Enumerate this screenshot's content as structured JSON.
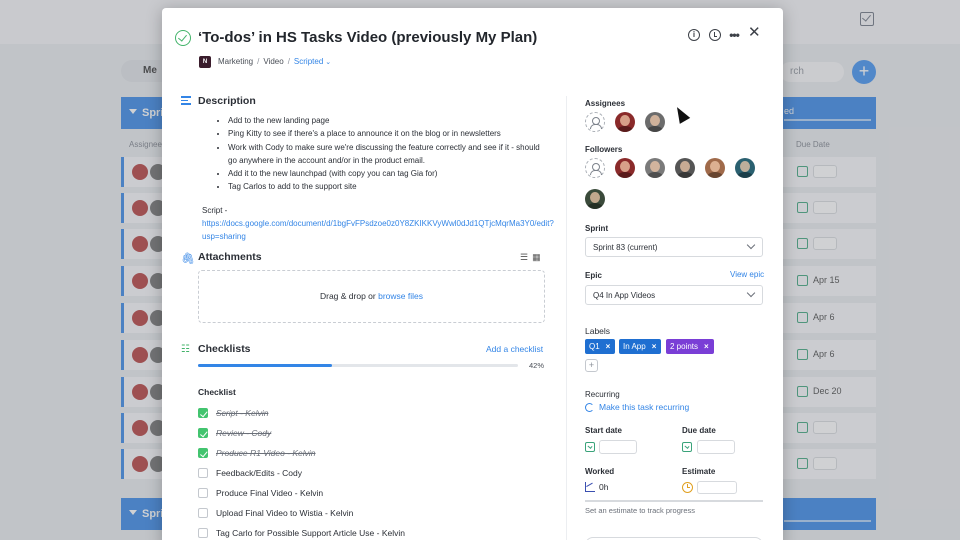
{
  "background": {
    "filter_pill": "Me",
    "search_placeholder": "rch",
    "sprint_bar_top": "Sprin",
    "sprint_bar_bottom": "Sprin",
    "sprint_bar_right_text": "ed",
    "col_assignees": "Assignees",
    "col_due_date": "Due Date",
    "row_dates": [
      "",
      "",
      "",
      "Apr 15",
      "Apr 6",
      "Apr 6",
      "Dec 20",
      "",
      ""
    ]
  },
  "modal": {
    "title": "‘To-dos’ in HS Tasks Video (previously My Plan)",
    "project_badge": "N",
    "breadcrumb": [
      "Marketing",
      "Video"
    ],
    "status": "Scripted",
    "header_icons": [
      "info-icon",
      "clock-icon",
      "more-icon",
      "close-icon"
    ]
  },
  "description": {
    "title": "Description",
    "bullets": [
      "Add to the new landing page",
      "Ping Kitty to see if there's a place to announce it on the blog or in newsletters",
      "Work with Cody to make sure we're discussing the feature correctly and see if it - should go anywhere in the account and/or in the product email.",
      "Add it to the new launchpad (with copy you can tag Gia for)",
      "Tag Carlos to add to the support site"
    ],
    "script_label": "Script - ",
    "script_url": "https://docs.google.com/document/d/1bgFvFPsdzoe0z0Y8ZKIKKVyWwl0dJd1QTjcMqrMa3Y0/edit?usp=sharing"
  },
  "attachments": {
    "title": "Attachments",
    "drop_text": "Drag & drop or ",
    "browse_link": "browse files"
  },
  "checklists": {
    "title": "Checklists",
    "add_label": "Add a checklist",
    "progress_percent": 42,
    "progress_label": "42%",
    "subtitle": "Checklist",
    "items": [
      {
        "text": "Script - Kelvin",
        "done": true
      },
      {
        "text": "Review - Cody",
        "done": true
      },
      {
        "text": "Produce R1 Video - Kelvin",
        "done": true
      },
      {
        "text": "Feedback/Edits - Cody",
        "done": false
      },
      {
        "text": "Produce Final Video - Kelvin",
        "done": false
      },
      {
        "text": "Upload Final Video to Wistia - Kelvin",
        "done": false
      },
      {
        "text": "Tag Carlo for Possible Support Article Use - Kelvin",
        "done": false
      }
    ]
  },
  "sidebar": {
    "assignees_label": "Assignees",
    "followers_label": "Followers",
    "sprint_label": "Sprint",
    "sprint_value": "Sprint 83 (current)",
    "epic_label": "Epic",
    "view_epic": "View epic",
    "epic_value": "Q4 In App Videos",
    "labels_label": "Labels",
    "tags": [
      {
        "text": "Q1",
        "color": "#1f6fd1"
      },
      {
        "text": "In App",
        "color": "#1f6fd1"
      },
      {
        "text": "2 points",
        "color": "#7a3ed6"
      }
    ],
    "tag_remove": "×",
    "tag_add": "+",
    "recurring_label": "Recurring",
    "recurring_link": "Make this task recurring",
    "start_date_label": "Start date",
    "due_date_label": "Due date",
    "worked_label": "Worked",
    "worked_value": "0h",
    "estimate_label": "Estimate",
    "estimate_hint": "Set an estimate to track progress"
  },
  "colors": {
    "accent": "#3385e6",
    "done_green": "#43c46f",
    "tag_blue": "#1f6fd1",
    "tag_purple": "#7a3ed6"
  }
}
